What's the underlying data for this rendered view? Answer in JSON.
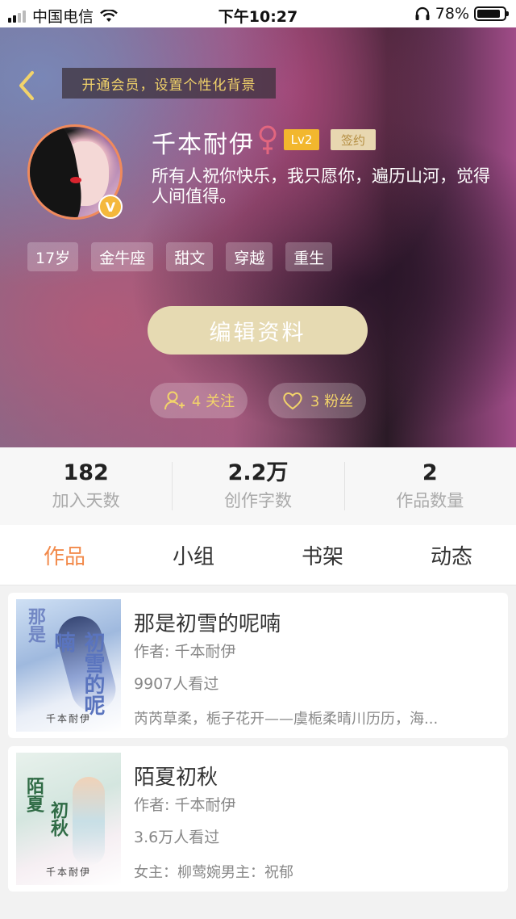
{
  "status_bar": {
    "carrier": "中国电信",
    "time": "下午10:27",
    "battery": "78%"
  },
  "header": {
    "vip_banner": "开通会员，设置个性化背景",
    "username": "千本耐伊",
    "level": "Lv2",
    "signed": "签约",
    "bio": "所有人祝你快乐，我只愿你，遍历山河，觉得人间值得。",
    "tags": [
      "17岁",
      "金牛座",
      "甜文",
      "穿越",
      "重生"
    ],
    "edit_button": "编辑资料",
    "follow": "4 关注",
    "fans": "3 粉丝"
  },
  "stats": [
    {
      "value": "182",
      "label": "加入天数"
    },
    {
      "value": "2.2万",
      "label": "创作字数"
    },
    {
      "value": "2",
      "label": "作品数量"
    }
  ],
  "tabs": [
    "作品",
    "小组",
    "书架",
    "动态"
  ],
  "books": [
    {
      "title": "那是初雪的呢喃",
      "author": "作者: 千本耐伊",
      "reads": "9907人看过",
      "desc": "芮芮草柔，栀子花开——虞栀柔晴川历历，海..."
    },
    {
      "title": "陌夏初秋",
      "author": "作者: 千本耐伊",
      "reads": "3.6万人看过",
      "desc": "女主：柳莺婉男主：祝郁"
    }
  ],
  "colors": {
    "accent_tab": "#f28a4b",
    "gold": "#f2d36a",
    "level_badge": "#f2b72e"
  }
}
